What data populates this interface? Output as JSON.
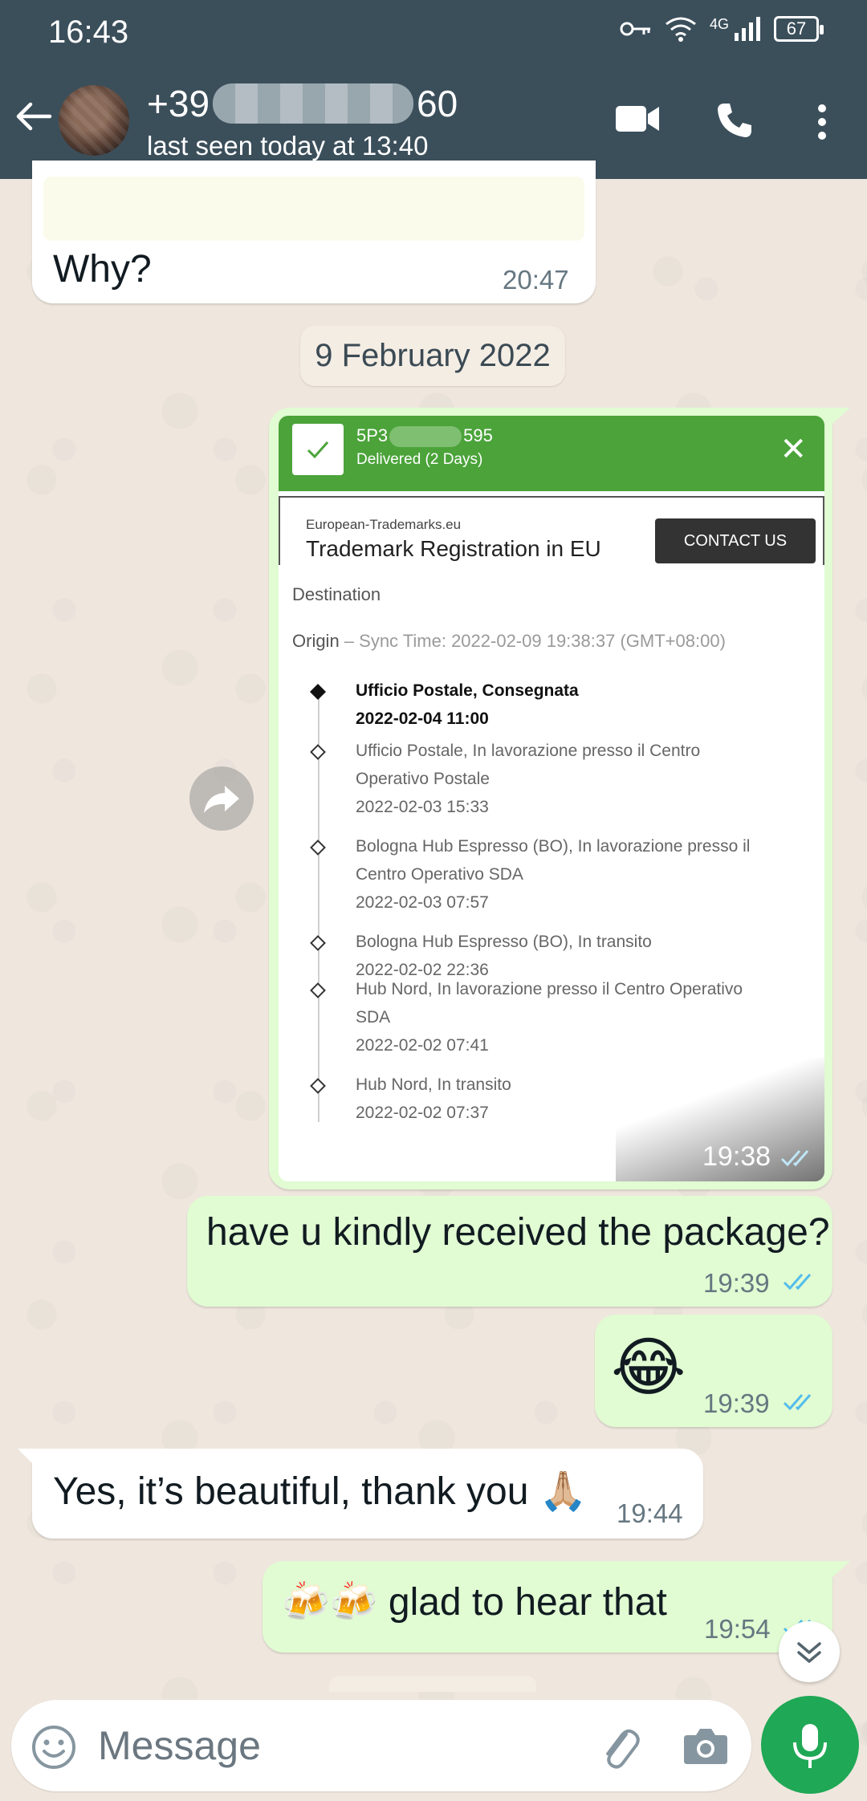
{
  "status_bar": {
    "time": "16:43",
    "network": "4G",
    "battery": "67"
  },
  "header": {
    "contact_prefix": "+39",
    "contact_suffix": "60",
    "last_seen": "last seen today at 13:40"
  },
  "messages": [
    {
      "id": "m1",
      "direction": "incoming",
      "text": "Why?",
      "time": "20:47"
    },
    {
      "id": "m2",
      "direction": "outgoing",
      "type": "image",
      "time": "19:38",
      "status": "read"
    },
    {
      "id": "m3",
      "direction": "outgoing",
      "text": "have u kindly received the package?",
      "time": "19:39",
      "status": "read"
    },
    {
      "id": "m4",
      "direction": "outgoing",
      "text": "😂",
      "time": "19:39",
      "status": "read"
    },
    {
      "id": "m5",
      "direction": "incoming",
      "text": "Yes, it’s beautiful, thank you 🙏🏼",
      "time": "19:44"
    },
    {
      "id": "m6",
      "direction": "outgoing",
      "text": "🍻🍻 glad to hear that",
      "time": "19:54",
      "status": "read"
    }
  ],
  "date_separator": "9 February 2022",
  "tracking_image": {
    "tracking_id_start": "5P3",
    "tracking_id_end": "595",
    "status": "Delivered (2 Days)",
    "ad_site": "European-Trademarks.eu",
    "ad_title": "Trademark Registration in EU",
    "ad_button": "CONTACT US",
    "destination_label": "Destination",
    "origin_label": "Origin",
    "sync_text": " – Sync Time: 2022-02-09 19:38:37 (GMT+08:00)",
    "events": [
      {
        "lines": [
          "Ufficio Postale, Consegnata",
          "2022-02-04 11:00"
        ],
        "active": true
      },
      {
        "lines": [
          "Ufficio Postale, In lavorazione presso il Centro",
          "Operativo Postale",
          "2022-02-03 15:33"
        ],
        "active": false
      },
      {
        "lines": [
          "Bologna Hub Espresso (BO), In lavorazione presso il",
          "Centro Operativo SDA",
          "2022-02-03 07:57"
        ],
        "active": false
      },
      {
        "lines": [
          "Bologna Hub Espresso (BO), In transito",
          "2022-02-02 22:36"
        ],
        "active": false
      },
      {
        "lines": [
          "Hub Nord, In lavorazione presso il Centro Operativo",
          "SDA",
          "2022-02-02 07:41"
        ],
        "active": false
      },
      {
        "lines": [
          "Hub Nord, In transito",
          "2022-02-02 07:37"
        ],
        "active": false
      }
    ]
  },
  "input": {
    "placeholder": "Message"
  },
  "icons": {
    "header": [
      "back-icon",
      "video-call-icon",
      "voice-call-icon",
      "more-options-icon"
    ],
    "input": [
      "emoji-icon",
      "attach-icon",
      "camera-icon",
      "mic-icon"
    ]
  },
  "colors": {
    "header_bg": "#3b4f5b",
    "outgoing_bubble": "#e1fbd2",
    "incoming_bubble": "#ffffff",
    "tick_read": "#53bdeb",
    "tracking_green": "#4ba33a",
    "mic_button": "#1fa855"
  }
}
